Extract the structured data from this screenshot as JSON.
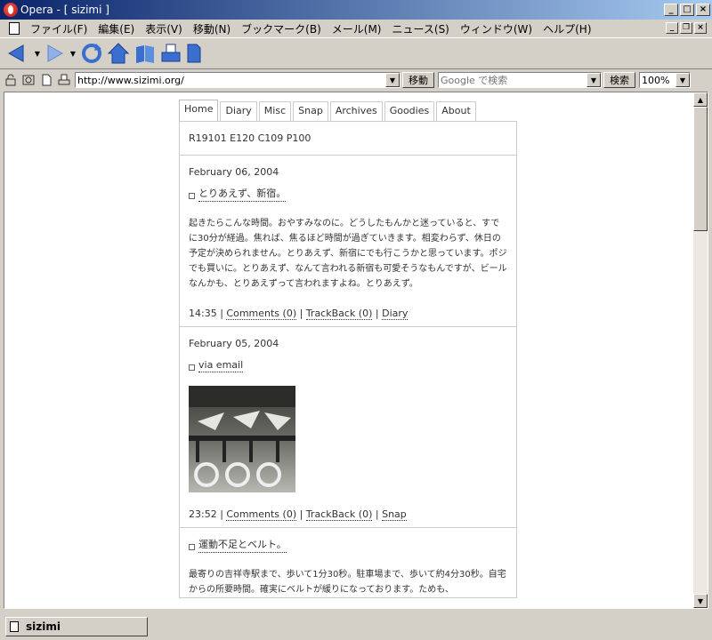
{
  "window": {
    "title": "Opera - [ sizimi ]"
  },
  "menu": {
    "items": [
      "ファイル(F)",
      "編集(E)",
      "表示(V)",
      "移動(N)",
      "ブックマーク(B)",
      "メール(M)",
      "ニュース(S)",
      "ウィンドウ(W)",
      "ヘルプ(H)"
    ]
  },
  "addressbar": {
    "url": "http://www.sizimi.org/",
    "go_label": "移動",
    "search_placeholder": "Google で検索",
    "search_label": "検索",
    "zoom": "100%"
  },
  "page": {
    "tabs": [
      "Home",
      "Diary",
      "Misc",
      "Snap",
      "Archives",
      "Goodies",
      "About"
    ],
    "active_tab": "Home",
    "counter": "R19101 E120 C109 P100",
    "entries": [
      {
        "date": "February 06, 2004",
        "title": "とりあえず、新宿。",
        "body": "起きたらこんな時間。おやすみなのに。どうしたもんかと迷っていると、すでに30分が経過。焦れば、焦るほど時間が過ぎていきます。相変わらず、休日の予定が決められません。とりあえず、新宿にでも行こうかと思っています。ポジでも買いに。とりあえず、なんて言われる新宿も可愛そうなもんですが、ビールなんかも、とりあえずって言われますよね。とりあえず。",
        "time": "14:35",
        "comments": "Comments (0)",
        "trackback": "TrackBack (0)",
        "category": "Diary"
      },
      {
        "date": "February 05, 2004",
        "title": "via email",
        "time": "23:52",
        "comments": "Comments (0)",
        "trackback": "TrackBack (0)",
        "category": "Snap"
      },
      {
        "title": "運動不足とベルト。",
        "body": "最寄りの吉祥寺駅まで、歩いて1分30秒。駐車場まで、歩いて約4分30秒。自宅からの所要時間。確実にベルトが緩りになっております。ためも、"
      }
    ]
  },
  "status": {
    "tab_label": "sizimi"
  },
  "colors": {
    "titlebar_start": "#0a246a",
    "titlebar_end": "#a6caf0",
    "chrome": "#d4d0c8"
  }
}
